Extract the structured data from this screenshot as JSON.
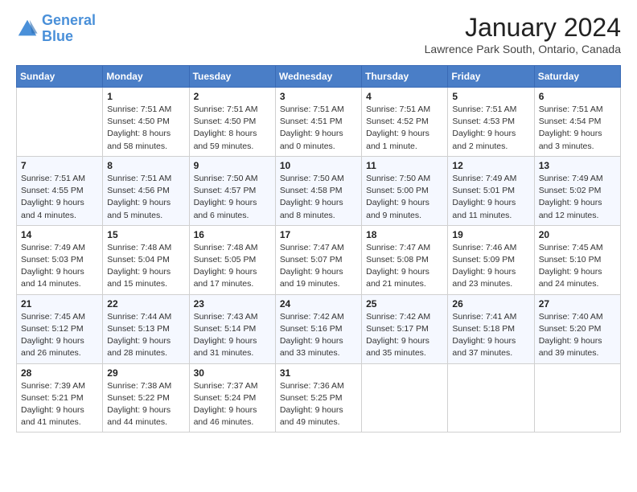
{
  "header": {
    "logo_line1": "General",
    "logo_line2": "Blue",
    "month": "January 2024",
    "location": "Lawrence Park South, Ontario, Canada"
  },
  "days_of_week": [
    "Sunday",
    "Monday",
    "Tuesday",
    "Wednesday",
    "Thursday",
    "Friday",
    "Saturday"
  ],
  "weeks": [
    [
      {
        "num": "",
        "info": ""
      },
      {
        "num": "1",
        "info": "Sunrise: 7:51 AM\nSunset: 4:50 PM\nDaylight: 8 hours\nand 58 minutes."
      },
      {
        "num": "2",
        "info": "Sunrise: 7:51 AM\nSunset: 4:50 PM\nDaylight: 8 hours\nand 59 minutes."
      },
      {
        "num": "3",
        "info": "Sunrise: 7:51 AM\nSunset: 4:51 PM\nDaylight: 9 hours\nand 0 minutes."
      },
      {
        "num": "4",
        "info": "Sunrise: 7:51 AM\nSunset: 4:52 PM\nDaylight: 9 hours\nand 1 minute."
      },
      {
        "num": "5",
        "info": "Sunrise: 7:51 AM\nSunset: 4:53 PM\nDaylight: 9 hours\nand 2 minutes."
      },
      {
        "num": "6",
        "info": "Sunrise: 7:51 AM\nSunset: 4:54 PM\nDaylight: 9 hours\nand 3 minutes."
      }
    ],
    [
      {
        "num": "7",
        "info": "Sunrise: 7:51 AM\nSunset: 4:55 PM\nDaylight: 9 hours\nand 4 minutes."
      },
      {
        "num": "8",
        "info": "Sunrise: 7:51 AM\nSunset: 4:56 PM\nDaylight: 9 hours\nand 5 minutes."
      },
      {
        "num": "9",
        "info": "Sunrise: 7:50 AM\nSunset: 4:57 PM\nDaylight: 9 hours\nand 6 minutes."
      },
      {
        "num": "10",
        "info": "Sunrise: 7:50 AM\nSunset: 4:58 PM\nDaylight: 9 hours\nand 8 minutes."
      },
      {
        "num": "11",
        "info": "Sunrise: 7:50 AM\nSunset: 5:00 PM\nDaylight: 9 hours\nand 9 minutes."
      },
      {
        "num": "12",
        "info": "Sunrise: 7:49 AM\nSunset: 5:01 PM\nDaylight: 9 hours\nand 11 minutes."
      },
      {
        "num": "13",
        "info": "Sunrise: 7:49 AM\nSunset: 5:02 PM\nDaylight: 9 hours\nand 12 minutes."
      }
    ],
    [
      {
        "num": "14",
        "info": "Sunrise: 7:49 AM\nSunset: 5:03 PM\nDaylight: 9 hours\nand 14 minutes."
      },
      {
        "num": "15",
        "info": "Sunrise: 7:48 AM\nSunset: 5:04 PM\nDaylight: 9 hours\nand 15 minutes."
      },
      {
        "num": "16",
        "info": "Sunrise: 7:48 AM\nSunset: 5:05 PM\nDaylight: 9 hours\nand 17 minutes."
      },
      {
        "num": "17",
        "info": "Sunrise: 7:47 AM\nSunset: 5:07 PM\nDaylight: 9 hours\nand 19 minutes."
      },
      {
        "num": "18",
        "info": "Sunrise: 7:47 AM\nSunset: 5:08 PM\nDaylight: 9 hours\nand 21 minutes."
      },
      {
        "num": "19",
        "info": "Sunrise: 7:46 AM\nSunset: 5:09 PM\nDaylight: 9 hours\nand 23 minutes."
      },
      {
        "num": "20",
        "info": "Sunrise: 7:45 AM\nSunset: 5:10 PM\nDaylight: 9 hours\nand 24 minutes."
      }
    ],
    [
      {
        "num": "21",
        "info": "Sunrise: 7:45 AM\nSunset: 5:12 PM\nDaylight: 9 hours\nand 26 minutes."
      },
      {
        "num": "22",
        "info": "Sunrise: 7:44 AM\nSunset: 5:13 PM\nDaylight: 9 hours\nand 28 minutes."
      },
      {
        "num": "23",
        "info": "Sunrise: 7:43 AM\nSunset: 5:14 PM\nDaylight: 9 hours\nand 31 minutes."
      },
      {
        "num": "24",
        "info": "Sunrise: 7:42 AM\nSunset: 5:16 PM\nDaylight: 9 hours\nand 33 minutes."
      },
      {
        "num": "25",
        "info": "Sunrise: 7:42 AM\nSunset: 5:17 PM\nDaylight: 9 hours\nand 35 minutes."
      },
      {
        "num": "26",
        "info": "Sunrise: 7:41 AM\nSunset: 5:18 PM\nDaylight: 9 hours\nand 37 minutes."
      },
      {
        "num": "27",
        "info": "Sunrise: 7:40 AM\nSunset: 5:20 PM\nDaylight: 9 hours\nand 39 minutes."
      }
    ],
    [
      {
        "num": "28",
        "info": "Sunrise: 7:39 AM\nSunset: 5:21 PM\nDaylight: 9 hours\nand 41 minutes."
      },
      {
        "num": "29",
        "info": "Sunrise: 7:38 AM\nSunset: 5:22 PM\nDaylight: 9 hours\nand 44 minutes."
      },
      {
        "num": "30",
        "info": "Sunrise: 7:37 AM\nSunset: 5:24 PM\nDaylight: 9 hours\nand 46 minutes."
      },
      {
        "num": "31",
        "info": "Sunrise: 7:36 AM\nSunset: 5:25 PM\nDaylight: 9 hours\nand 49 minutes."
      },
      {
        "num": "",
        "info": ""
      },
      {
        "num": "",
        "info": ""
      },
      {
        "num": "",
        "info": ""
      }
    ]
  ]
}
